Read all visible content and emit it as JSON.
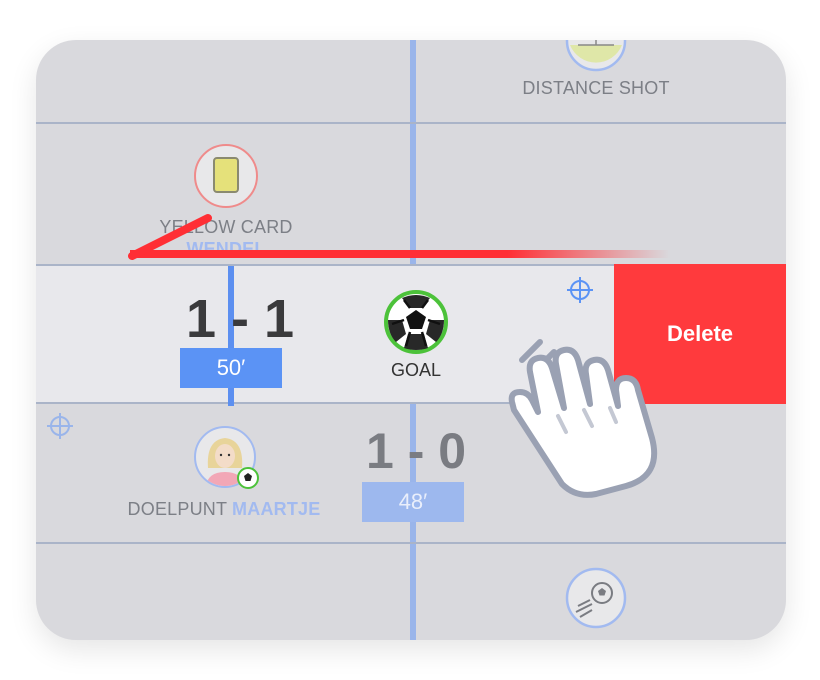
{
  "events": {
    "distance_shot": {
      "label": "DISTANCE SHOT"
    },
    "yellow_card": {
      "label_part": "YELLOW CARD",
      "player": "WENDEL"
    },
    "goal_row": {
      "score": "1 - 1",
      "minute": "50′",
      "label": "GOAL",
      "delete_label": "Delete"
    },
    "doelpunt": {
      "label_prefix": "DOELPUNT",
      "player": "MAARTJE",
      "score": "1 - 0",
      "minute": "48′"
    }
  },
  "colors": {
    "timeline": "#9ab5ea",
    "timeline_active": "#5c8ff0",
    "delete": "#ff3a3d",
    "swipe": "#ff2f35"
  },
  "icons": [
    "yellow-card-icon",
    "soccer-ball-icon",
    "player-avatar-icon",
    "crosshair-icon",
    "distance-shot-icon",
    "hand-swipe-icon"
  ]
}
